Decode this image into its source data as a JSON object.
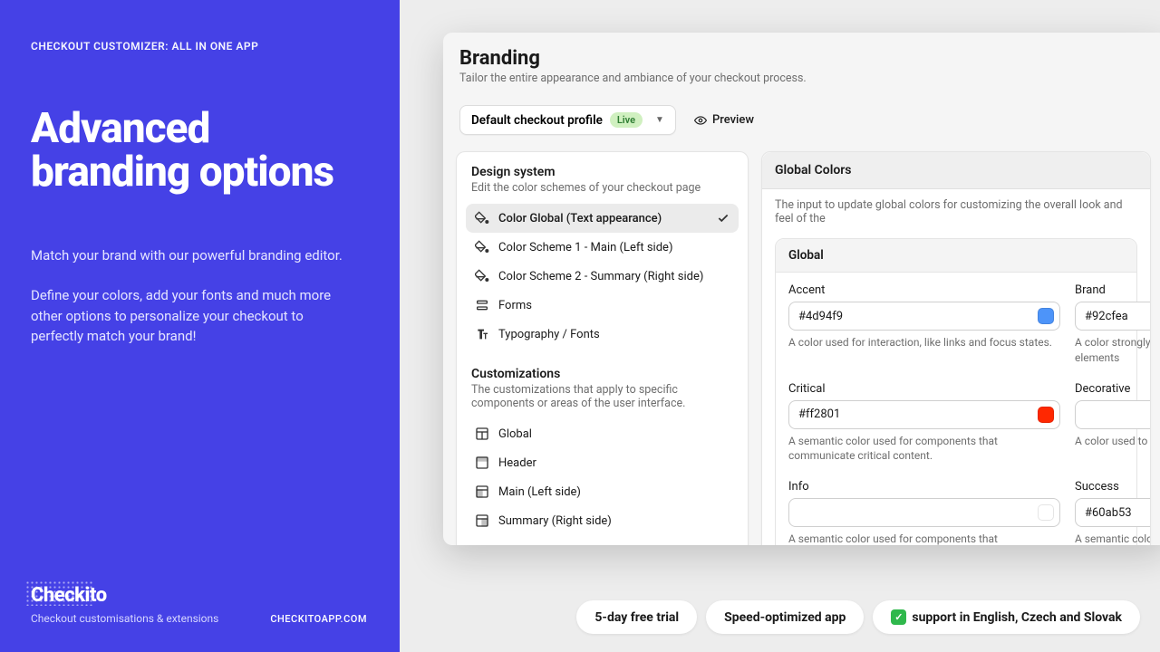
{
  "leftPanel": {
    "eyebrow": "CHECKOUT CUSTOMIZER: ALL IN ONE APP",
    "title": "Advanced branding options",
    "desc1": "Match your brand with our powerful branding editor.",
    "desc2": "Define your colors, add your fonts and much more other options to personalize your checkout to perfectly match your brand!",
    "brandName": "Checkito",
    "brandSub": "Checkout customisations & extensions",
    "brandUrl": "CHECKITOAPP.COM"
  },
  "page": {
    "title": "Branding",
    "subtitle": "Tailor the entire appearance and ambiance of your checkout process."
  },
  "toolbar": {
    "profileLabel": "Default checkout profile",
    "liveBadge": "Live",
    "previewLabel": "Preview"
  },
  "designSystem": {
    "title": "Design system",
    "subtitle": "Edit the color schemes of your checkout page",
    "items": [
      "Color Global (Text appearance)",
      "Color Scheme 1 - Main (Left side)",
      "Color Scheme 2 - Summary (Right side)",
      "Forms",
      "Typography / Fonts"
    ]
  },
  "customizations": {
    "title": "Customizations",
    "subtitle": "The customizations that apply to specific components or areas of the user interface.",
    "items": [
      "Global",
      "Header",
      "Main (Left side)",
      "Summary (Right side)"
    ]
  },
  "globalColors": {
    "header": "Global Colors",
    "desc": "The input to update global colors for customizing the overall look and feel of the",
    "innerHeader": "Global",
    "fields": [
      {
        "label": "Accent",
        "value": "#4d94f9",
        "swatch": "#4d94f9",
        "help": "A color used for interaction, like links and focus states."
      },
      {
        "label": "Brand",
        "value": "#92cfea",
        "swatch": "#92cfea",
        "help": "A color strongly associated with the merchant, used for elements"
      },
      {
        "label": "Critical",
        "value": "#ff2801",
        "swatch": "#ff2801",
        "help": "A semantic color used for components that communicate critical content."
      },
      {
        "label": "Decorative",
        "value": "",
        "swatch": "",
        "help": "A color used to highlight certain areas of the interface."
      },
      {
        "label": "Info",
        "value": "",
        "swatch": "",
        "help": "A semantic color used for components that communicate informative content."
      },
      {
        "label": "Success",
        "value": "#60ab53",
        "swatch": "#60ab53",
        "help": "A semantic color used for components that communicate su"
      }
    ]
  },
  "pills": {
    "trial": "5-day free trial",
    "speed": "Speed-optimized app",
    "support": "support in English, Czech and Slovak"
  }
}
